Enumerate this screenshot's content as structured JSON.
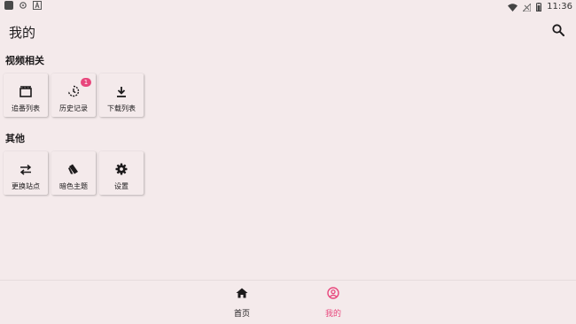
{
  "status_bar": {
    "time": "11:36"
  },
  "header": {
    "title": "我的",
    "search_icon": "search-icon"
  },
  "sections": [
    {
      "title": "视频相关",
      "items": [
        {
          "label": "追番列表",
          "icon": "clapperboard-icon"
        },
        {
          "label": "历史记录",
          "icon": "history-icon",
          "badge": "1"
        },
        {
          "label": "下载列表",
          "icon": "download-icon"
        }
      ]
    },
    {
      "title": "其他",
      "items": [
        {
          "label": "更换站点",
          "icon": "swap-icon"
        },
        {
          "label": "暗色主题",
          "icon": "dark-theme-icon"
        },
        {
          "label": "设置",
          "icon": "gear-icon"
        }
      ]
    }
  ],
  "bottom_nav": [
    {
      "label": "首页",
      "icon": "home-icon",
      "active": false
    },
    {
      "label": "我的",
      "icon": "account-circle-icon",
      "active": true
    }
  ],
  "colors": {
    "background": "#f4eaeb",
    "accent": "#e8467c",
    "text": "#1d1b1c"
  }
}
